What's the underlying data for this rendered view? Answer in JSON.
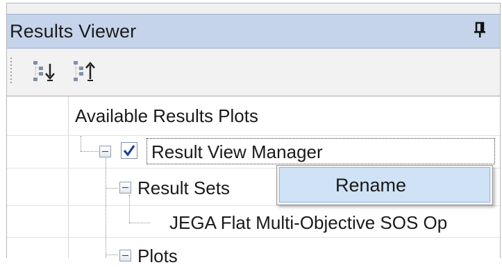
{
  "panel": {
    "title": "Results Viewer"
  },
  "icons": {
    "pin": "pin-icon",
    "expand_all": "expand-all-icon",
    "collapse_all": "collapse-all-icon",
    "checkbox": "checkbox-checked-icon"
  },
  "tree": {
    "header": "Available Results Plots",
    "items": [
      {
        "label": "Result View Manager",
        "checked": true,
        "expanded": true
      },
      {
        "label": "Result Sets",
        "expanded": true
      },
      {
        "label": "JEGA Flat Multi-Objective SOS Op"
      },
      {
        "label": "Plots",
        "expanded": true
      }
    ]
  },
  "context_menu": {
    "items": [
      {
        "label": "Rename"
      }
    ]
  },
  "colors": {
    "header_bg": "#c5d4ea",
    "menu_highlight": "#cfe2f6",
    "checkmark": "#1e3f9e"
  }
}
